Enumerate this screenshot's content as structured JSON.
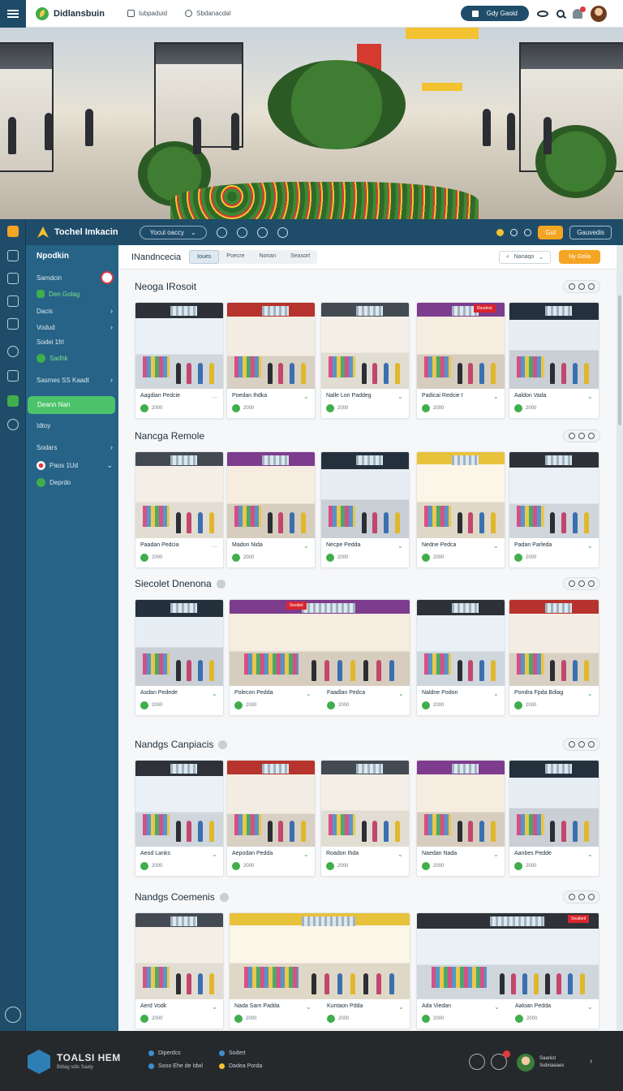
{
  "topbar": {
    "app_name": "Didlansbuin",
    "links": [
      "Iubpaduid",
      "Sbdanacdal"
    ],
    "pill_label": "Gdy Gaoid"
  },
  "appbar": {
    "brand": "Tochel Imkacin",
    "search_pill": "Yocul oaccy",
    "btn_primary": "Gut",
    "btn_secondary": "Gauvedis"
  },
  "sidebar": {
    "title": "Npodkin",
    "items": [
      {
        "label": "Samdcin",
        "chevron": false
      },
      {
        "label": "Den Golag",
        "chevron": false
      },
      {
        "label": "Dacis",
        "chevron": true
      },
      {
        "label": "Vodud",
        "chevron": true
      },
      {
        "label": "Sodei 1frl",
        "chevron": false
      },
      {
        "label": "Sadhk",
        "chevron": false
      },
      {
        "label": "Sasmes SS Kaadt",
        "chevron": true
      },
      {
        "label": "Deann Nan",
        "chevron": false
      },
      {
        "label": "Idtoy",
        "chevron": false
      },
      {
        "label": "Sodars",
        "chevron": true
      },
      {
        "label": "Paos 1Ud",
        "chevron": true
      },
      {
        "label": "Deprdo",
        "chevron": false
      }
    ]
  },
  "main": {
    "title": "INandncecia",
    "tabs": [
      "Ioues",
      "Poecre",
      "Nonan",
      "Seasort"
    ],
    "active_tab": "Ioues",
    "select_label": "Nanaqo",
    "action_button": "Ny Gelia"
  },
  "sections": [
    {
      "title": "Neoga IRosoit",
      "cards": [
        {
          "caption": "Aagdian Pedcie",
          "meta": "2000",
          "extra": "..."
        },
        {
          "caption": "Poedan Ihdka",
          "meta": "2000"
        },
        {
          "caption": "Nalle Lon Paddeg",
          "meta": "2000"
        },
        {
          "caption": "Padicai Redcie I",
          "meta": "2000",
          "tag": "Reudest"
        },
        {
          "caption": "Aaldon Vada",
          "meta": "2000"
        }
      ]
    },
    {
      "title": "Nancga Remole",
      "cards": [
        {
          "caption": "Paadan Pedcia",
          "meta": "2000",
          "extra": "..."
        },
        {
          "caption": "Madon Nida",
          "meta": "2000"
        },
        {
          "caption": "Necpe Pedda",
          "meta": "2000"
        },
        {
          "caption": "Nedne Pedca",
          "meta": "2000"
        },
        {
          "caption": "Padan Parleda",
          "meta": "2000"
        }
      ]
    },
    {
      "title": "Siecolet Dnenona",
      "cards": [
        {
          "caption": "Asdan Pedede",
          "meta": "2000"
        },
        {
          "caption": "Polecon Pedda",
          "meta": "2000",
          "tag": "Sexdiet"
        },
        {
          "caption": "Faadlan Pedca",
          "meta": "2000"
        },
        {
          "caption": "Naldne Podon",
          "meta": "2000"
        },
        {
          "caption": "Pondra Fpda Bdiag",
          "meta": "2000"
        }
      ]
    },
    {
      "title": "Nandgs Canpiacis",
      "cards": [
        {
          "caption": "Aeod Lanks",
          "meta": "2000"
        },
        {
          "caption": "Aepodan Pedda",
          "meta": "2000"
        },
        {
          "caption": "Roadon Ihda",
          "meta": "2000"
        },
        {
          "caption": "Naedan Nada",
          "meta": "2000"
        },
        {
          "caption": "Aanbes Pedde",
          "meta": "2000"
        }
      ]
    },
    {
      "title": "Nandgs Coemenis",
      "cards": [
        {
          "caption": "Aerd Vodk",
          "meta": "2000"
        },
        {
          "caption": "Nada Sarn Padda",
          "meta": "2000"
        },
        {
          "caption": "Kuntaon Pdda",
          "meta": "2000"
        },
        {
          "caption": "Ada Viedan",
          "meta": "2000"
        },
        {
          "caption": "Aaloan Pedda",
          "meta": "2000",
          "tag": "Seuibeit"
        }
      ]
    }
  ],
  "footer": {
    "brand": "TOALSI HEM",
    "tagline": "Bdtag sdis Saaty",
    "links": [
      "Diperdcs",
      "Sodert",
      "Sooo Ehe de Idwl",
      "Dadea Porda"
    ],
    "user_line1": "Saanist",
    "user_line2": "Sobriaeaes"
  }
}
